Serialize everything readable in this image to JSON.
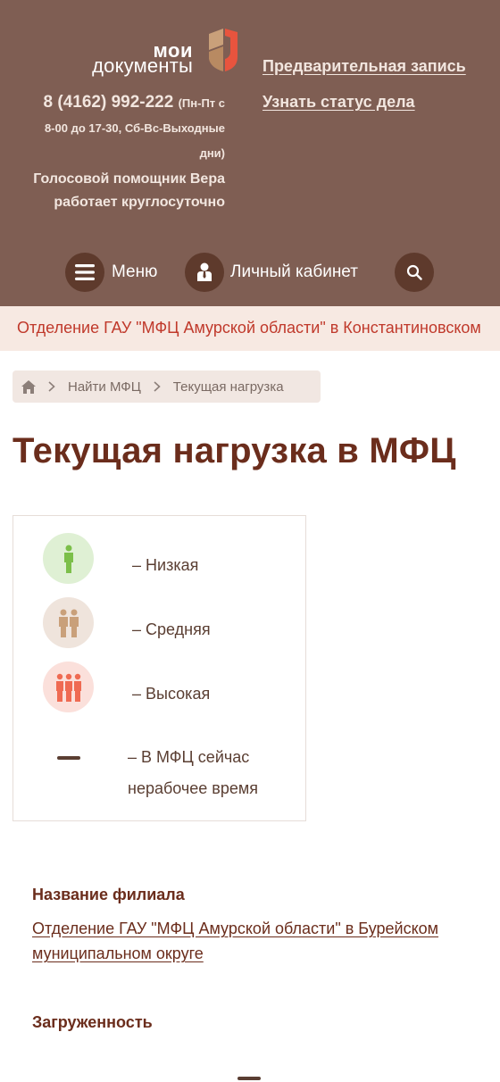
{
  "header": {
    "logo": {
      "line1": "мои",
      "line2": "документы"
    },
    "phone": "8 (4162) 992-222",
    "hours_line1": "(Пн-Пт с",
    "hours_line2": "8-00 до 17-30, Сб-Вс-Выходные",
    "hours_line3": "дни)",
    "voice_line1": "Голосовой помощник Вера",
    "voice_line2": "работает круглосуточно",
    "link_appointment": "Предварительная запись",
    "link_status": "Узнать статус дела",
    "menu_label": "Меню",
    "cabinet_label": "Личный кабинет"
  },
  "banner": {
    "text": "Отделение ГАУ \"МФЦ Амурской области\" в Константиновском"
  },
  "breadcrumb": {
    "items": [
      "Найти МФЦ",
      "Текущая нагрузка"
    ]
  },
  "page_title": "Текущая нагрузка в МФЦ",
  "legend": {
    "low": "– Низкая",
    "medium": "– Средняя",
    "high": "– Высокая",
    "closed_line1": "– В МФЦ сейчас",
    "closed_line2": "нерабочее время"
  },
  "branch": {
    "heading": "Название филиала",
    "link_text": "Отделение ГАУ \"МФЦ Амурской области\" в Бурейском муниципальном округе"
  },
  "load": {
    "heading": "Загруженность"
  },
  "colors": {
    "header_bg": "#7f5e53",
    "button_bg": "#5e3a2c",
    "title": "#6b2d1c",
    "banner_text": "#c0392b",
    "low": "#7cbf4a",
    "medium": "#c9a07a",
    "high": "#ef6a52"
  }
}
